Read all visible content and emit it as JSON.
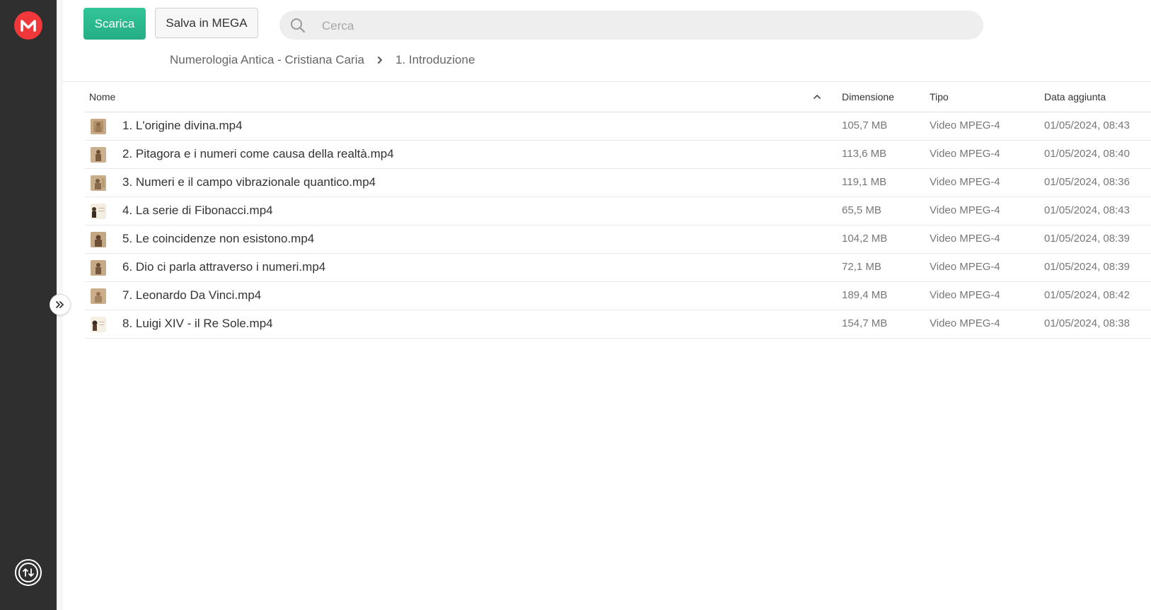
{
  "toolbar": {
    "download_label": "Scarica",
    "save_label": "Salva in MEGA"
  },
  "search": {
    "placeholder": "Cerca",
    "value": ""
  },
  "breadcrumb": {
    "items": [
      "Numerologia Antica - Cristiana Caria",
      "1. Introduzione"
    ]
  },
  "table": {
    "columns": {
      "name": "Nome",
      "size": "Dimensione",
      "type": "Tipo",
      "date": "Data aggiunta"
    },
    "sort": "ascending",
    "rows": [
      {
        "name": "1. L'origine divina.mp4",
        "size": "105,7 MB",
        "type": "Video MPEG-4",
        "date": "01/05/2024, 08:43"
      },
      {
        "name": "2. Pitagora e i numeri come causa della realtà.mp4",
        "size": "113,6 MB",
        "type": "Video MPEG-4",
        "date": "01/05/2024, 08:40"
      },
      {
        "name": "3. Numeri e il campo vibrazionale quantico.mp4",
        "size": "119,1 MB",
        "type": "Video MPEG-4",
        "date": "01/05/2024, 08:36"
      },
      {
        "name": "4. La serie di Fibonacci.mp4",
        "size": "65,5 MB",
        "type": "Video MPEG-4",
        "date": "01/05/2024, 08:43"
      },
      {
        "name": "5. Le coincidenze non esistono.mp4",
        "size": "104,2 MB",
        "type": "Video MPEG-4",
        "date": "01/05/2024, 08:39"
      },
      {
        "name": "6. Dio ci parla attraverso i numeri.mp4",
        "size": "72,1 MB",
        "type": "Video MPEG-4",
        "date": "01/05/2024, 08:39"
      },
      {
        "name": "7. Leonardo Da Vinci.mp4",
        "size": "189,4 MB",
        "type": "Video MPEG-4",
        "date": "01/05/2024, 08:42"
      },
      {
        "name": "8. Luigi XIV - il Re Sole.mp4",
        "size": "154,7 MB",
        "type": "Video MPEG-4",
        "date": "01/05/2024, 08:38"
      }
    ]
  },
  "icons": {
    "logo": "mega-logo-icon",
    "search": "search-icon",
    "transfers": "transfers-icon",
    "collapse": "expand-sidebar-icon",
    "sort": "sort-ascending-icon",
    "file_thumb": "video-thumbnail"
  },
  "colors": {
    "brand": "#f0373a",
    "primary_button": "#2bb88e",
    "sidebar": "#2f2f2f"
  }
}
